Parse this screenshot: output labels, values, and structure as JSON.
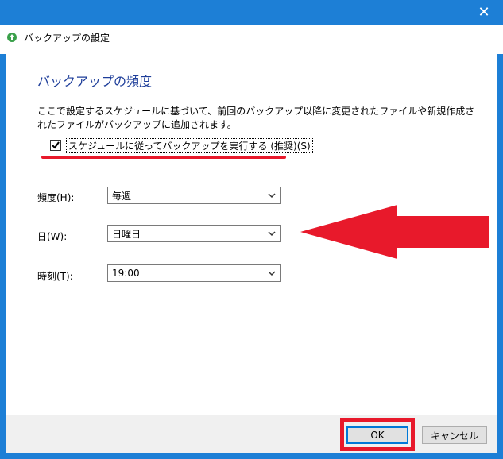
{
  "window": {
    "title": "バックアップの設定",
    "close_glyph": "✕"
  },
  "content": {
    "heading": "バックアップの頻度",
    "description": "ここで設定するスケジュールに基づいて、前回のバックアップ以降に変更されたファイルや新規作成されたファイルがバックアップに追加されます。",
    "schedule_checkbox": {
      "label": "スケジュールに従ってバックアップを実行する (推奨)(S)",
      "checked": true
    }
  },
  "fields": {
    "frequency": {
      "label": "頻度(H):",
      "value": "毎週"
    },
    "day": {
      "label": "日(W):",
      "value": "日曜日"
    },
    "time": {
      "label": "時刻(T):",
      "value": "19:00"
    }
  },
  "buttons": {
    "ok": "OK",
    "cancel": "キャンセル"
  },
  "colors": {
    "titlebar": "#1d7fd6",
    "heading": "#1e3e9a",
    "annotation_red": "#e8192b"
  }
}
